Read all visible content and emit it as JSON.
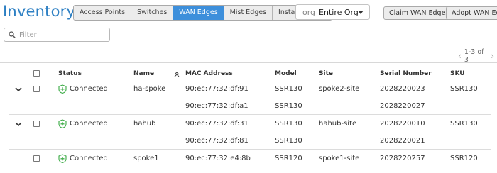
{
  "page": {
    "title": "Inventory"
  },
  "tabs": [
    {
      "label": "Access Points",
      "active": false
    },
    {
      "label": "Switches",
      "active": false
    },
    {
      "label": "WAN Edges",
      "active": true
    },
    {
      "label": "Mist Edges",
      "active": false
    },
    {
      "label": "Installed Base",
      "active": false
    }
  ],
  "org_select": {
    "prefix": "org",
    "value": "Entire Org"
  },
  "actions": {
    "claim_label": "Claim WAN Edges",
    "adopt_label": "Adopt WAN Edg"
  },
  "filter": {
    "placeholder": "Filter",
    "value": ""
  },
  "pagination": {
    "range": "1-3 of 3"
  },
  "colors": {
    "accent": "#2c7fc3",
    "active_tab": "#3d8fdb",
    "connected": "#3bab45"
  },
  "table": {
    "columns": {
      "status": "Status",
      "name": "Name",
      "mac": "MAC Address",
      "model": "Model",
      "site": "Site",
      "serial": "Serial Number",
      "sku": "SKU"
    },
    "rows": [
      {
        "status": "Connected",
        "name": "ha-spoke",
        "mac": "90:ec:77:32:df:91",
        "model": "SSR130",
        "site": "spoke2-site",
        "serial": "2028220023",
        "sku": "SSR130",
        "expandable": true,
        "sub": {
          "mac": "90:ec:77:32:df:a1",
          "model": "SSR130",
          "serial": "2028220027"
        }
      },
      {
        "status": "Connected",
        "name": "hahub",
        "mac": "90:ec:77:32:df:31",
        "model": "SSR130",
        "site": "hahub-site",
        "serial": "2028220010",
        "sku": "SSR130",
        "expandable": true,
        "sub": {
          "mac": "90:ec:77:32:df:81",
          "model": "SSR130",
          "serial": "2028220021"
        }
      },
      {
        "status": "Connected",
        "name": "spoke1",
        "mac": "90:ec:77:32:e4:8b",
        "model": "SSR120",
        "site": "spoke1-site",
        "serial": "2028220257",
        "sku": "SSR120",
        "expandable": false
      }
    ]
  }
}
